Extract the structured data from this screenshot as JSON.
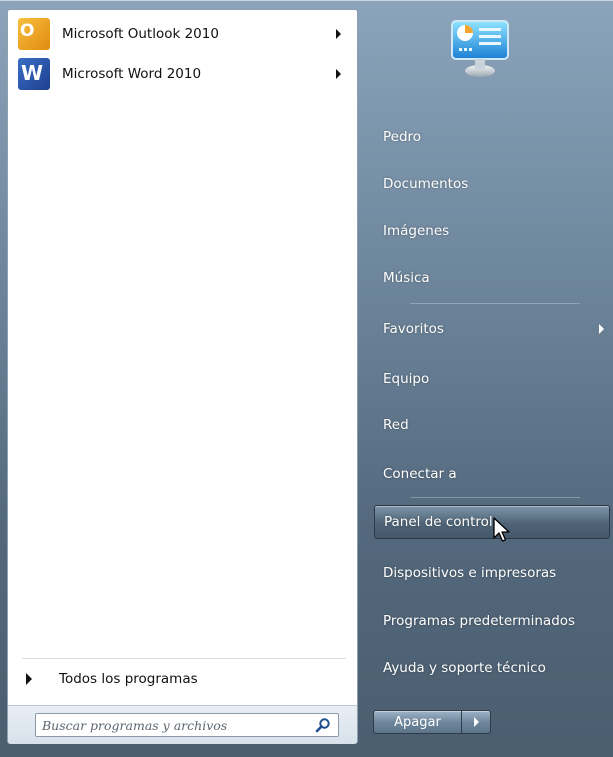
{
  "pinned_programs": [
    {
      "label": "Microsoft Outlook 2010",
      "icon": "outlook-icon"
    },
    {
      "label": "Microsoft Word 2010",
      "icon": "word-icon"
    }
  ],
  "all_programs_label": "Todos los programas",
  "search": {
    "placeholder": "Buscar programas y archivos",
    "icon": "search-icon"
  },
  "user_picture_icon": "control-panel-picture-icon",
  "right_items": [
    {
      "label": "Pedro"
    },
    {
      "label": "Documentos"
    },
    {
      "label": "Imágenes"
    },
    {
      "label": "Música"
    },
    {
      "label": "Favoritos",
      "has_submenu": true
    },
    {
      "label": "Equipo"
    },
    {
      "label": "Red"
    },
    {
      "label": "Conectar a"
    },
    {
      "label": "Panel de control",
      "highlighted": true
    },
    {
      "label": "Dispositivos e impresoras"
    },
    {
      "label": "Programas predeterminados"
    },
    {
      "label": "Ayuda y soporte técnico"
    }
  ],
  "shutdown": {
    "label": "Apagar",
    "arrow_icon": "chevron-right-icon"
  },
  "colors": {
    "menu_bg": "#6f879d",
    "left_pane_bg": "#ffffff",
    "highlight": "#4f6477"
  }
}
